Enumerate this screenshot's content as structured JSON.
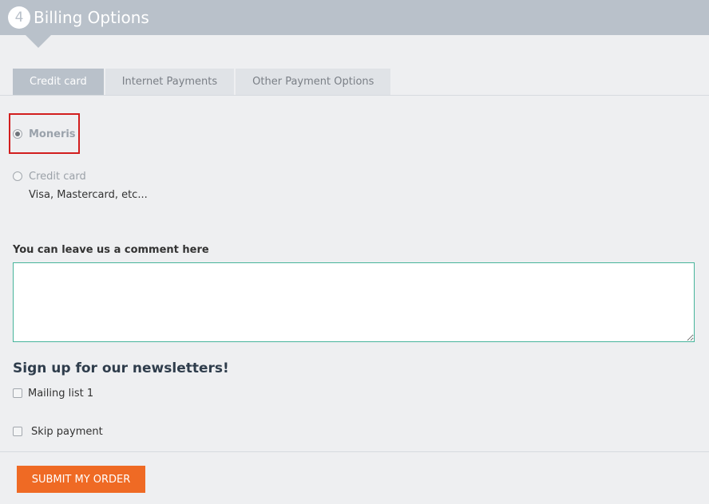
{
  "header": {
    "step_number": "4",
    "title": "Billing Options"
  },
  "tabs": [
    {
      "label": "Credit card",
      "active": true
    },
    {
      "label": "Internet Payments",
      "active": false
    },
    {
      "label": "Other Payment Options",
      "active": false
    }
  ],
  "payment_options": [
    {
      "label": "Moneris",
      "selected": true,
      "description": ""
    },
    {
      "label": "Credit card",
      "selected": false,
      "description": "Visa, Mastercard, etc..."
    }
  ],
  "comment": {
    "label": "You can leave us a comment here",
    "value": ""
  },
  "newsletter": {
    "title": "Sign up for our newsletters!",
    "lists": [
      {
        "label": "Mailing list 1",
        "checked": false
      }
    ]
  },
  "skip_payment": {
    "label": "Skip payment",
    "checked": false
  },
  "submit": {
    "label": "SUBMIT MY ORDER"
  },
  "colors": {
    "header": "#b9c1ca",
    "accent": "#ef6a24",
    "highlight": "#d21e1e",
    "textarea_border": "#47b49b"
  }
}
